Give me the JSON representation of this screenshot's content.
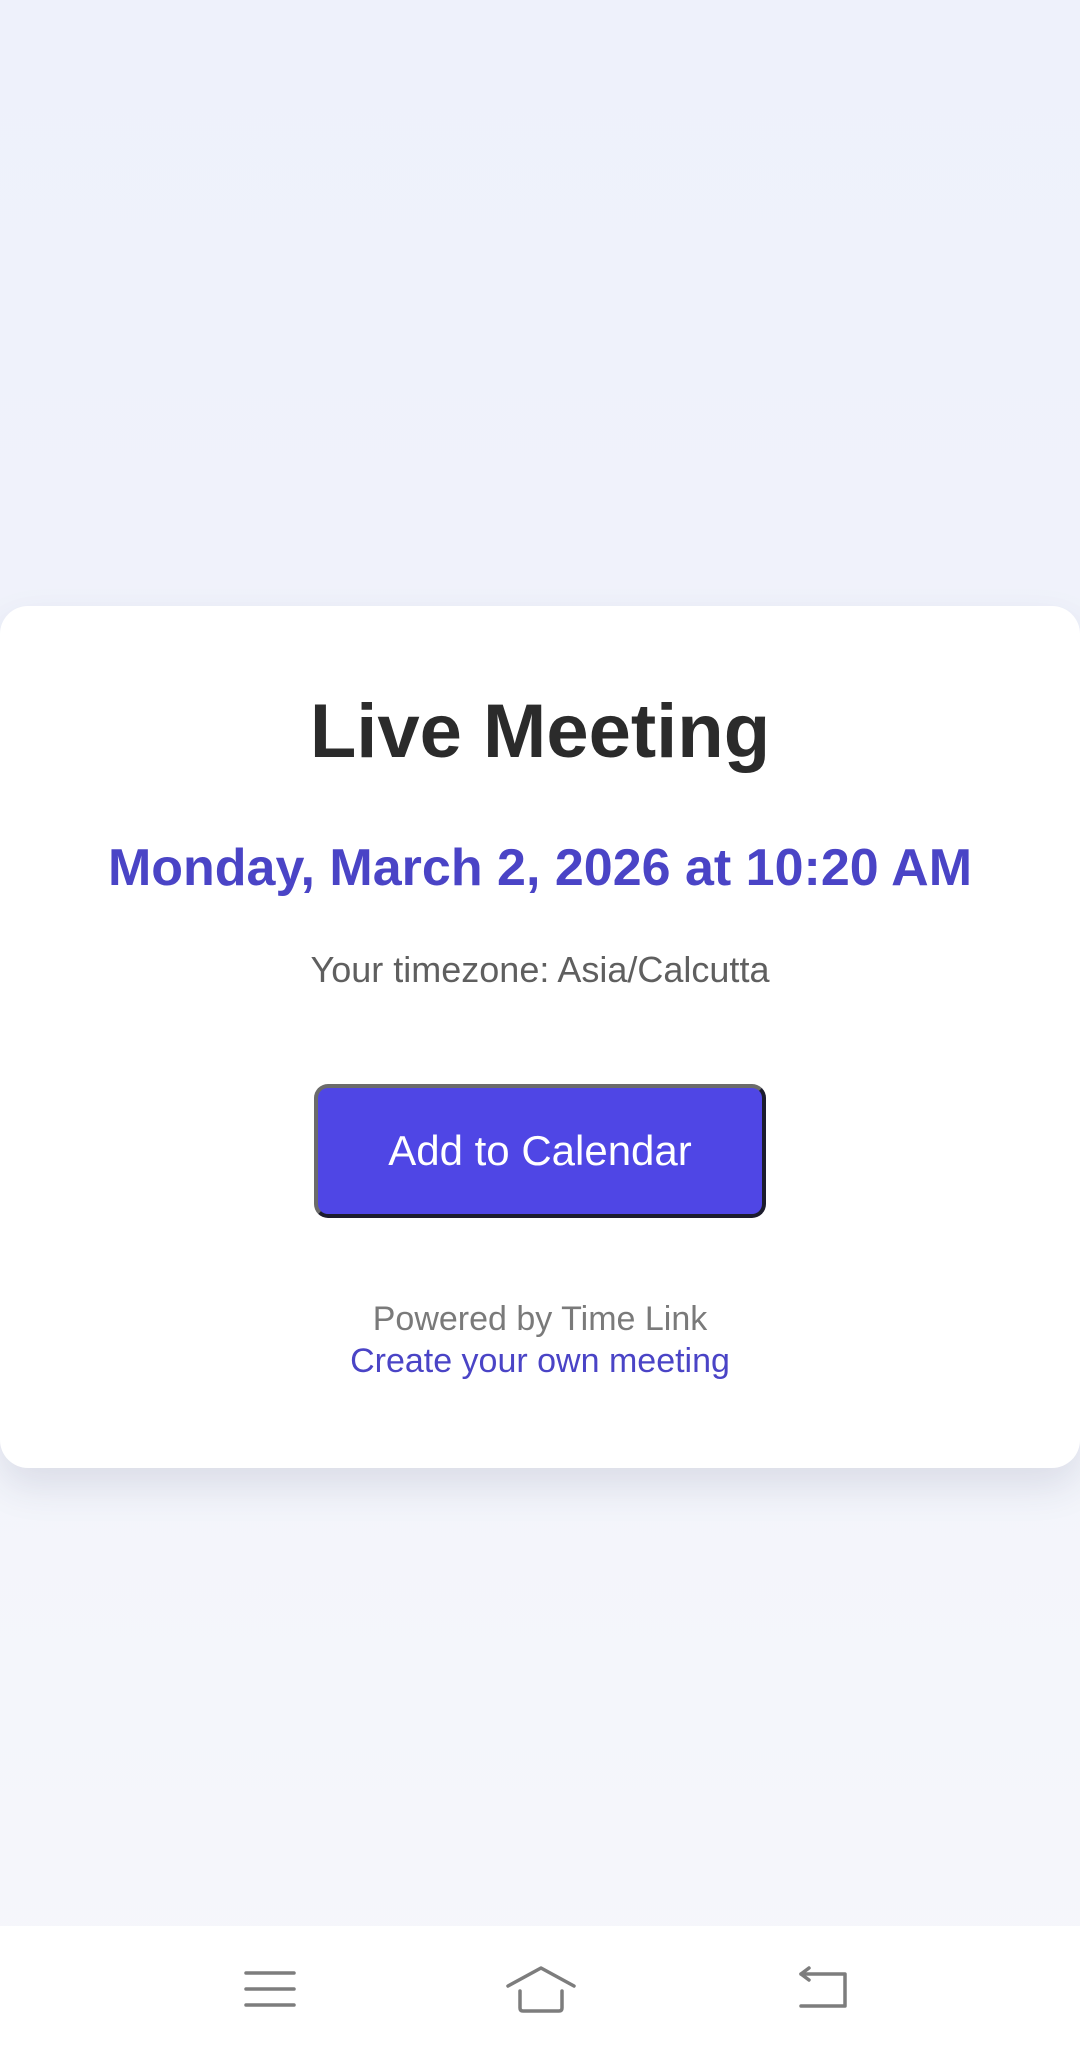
{
  "meeting": {
    "title": "Live Meeting",
    "datetime": "Monday, March 2, 2026 at 10:20 AM",
    "timezone": "Your timezone: Asia/Calcutta",
    "add_button_label": "Add to Calendar"
  },
  "footer": {
    "powered_by": "Powered by Time Link",
    "create_link": "Create your own meeting"
  },
  "navbar": {
    "icons": [
      "menu-icon",
      "home-icon",
      "back-icon"
    ]
  },
  "colors": {
    "accent": "#4f46e5",
    "accent_text": "#4a44c6",
    "title": "#2b2b2b",
    "background": "#eef1fb"
  }
}
